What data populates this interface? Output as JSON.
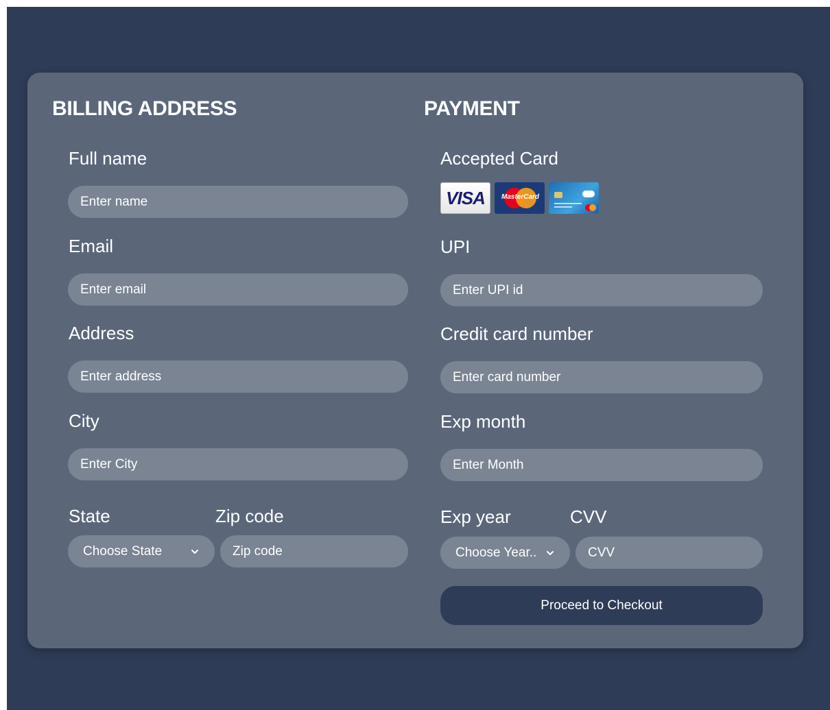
{
  "billing": {
    "title": "BILLING ADDRESS",
    "full_name": {
      "label": "Full name",
      "placeholder": "Enter name"
    },
    "email": {
      "label": "Email",
      "placeholder": "Enter email"
    },
    "address": {
      "label": "Address",
      "placeholder": "Enter address"
    },
    "city": {
      "label": "City",
      "placeholder": "Enter City"
    },
    "state": {
      "label": "State",
      "selected": "Choose State"
    },
    "zip": {
      "label": "Zip code",
      "placeholder": "Zip code"
    }
  },
  "payment": {
    "title": "PAYMENT",
    "accepted_card": {
      "label": "Accepted Card",
      "cards": [
        "VISA",
        "MasterCard",
        "credit-card-generic"
      ]
    },
    "upi": {
      "label": "UPI",
      "placeholder": "Enter UPI id"
    },
    "card_number": {
      "label": "Credit card number",
      "placeholder": "Enter card number"
    },
    "exp_month": {
      "label": "Exp month",
      "placeholder": "Enter Month"
    },
    "exp_year": {
      "label": "Exp year",
      "selected": "Choose Year.."
    },
    "cvv": {
      "label": "CVV",
      "placeholder": "CVV"
    },
    "checkout_label": "Proceed to Checkout"
  },
  "colors": {
    "page_background": "#2f3c57",
    "card_background": "#5b6779",
    "input_background": "#7a8493",
    "button_background": "#2f3c57",
    "text": "#ffffff"
  },
  "icons": {
    "select_chevron": "chevron-down-icon",
    "visa": "visa-card-icon",
    "mastercard": "mastercard-icon",
    "generic_card": "credit-card-icon"
  }
}
